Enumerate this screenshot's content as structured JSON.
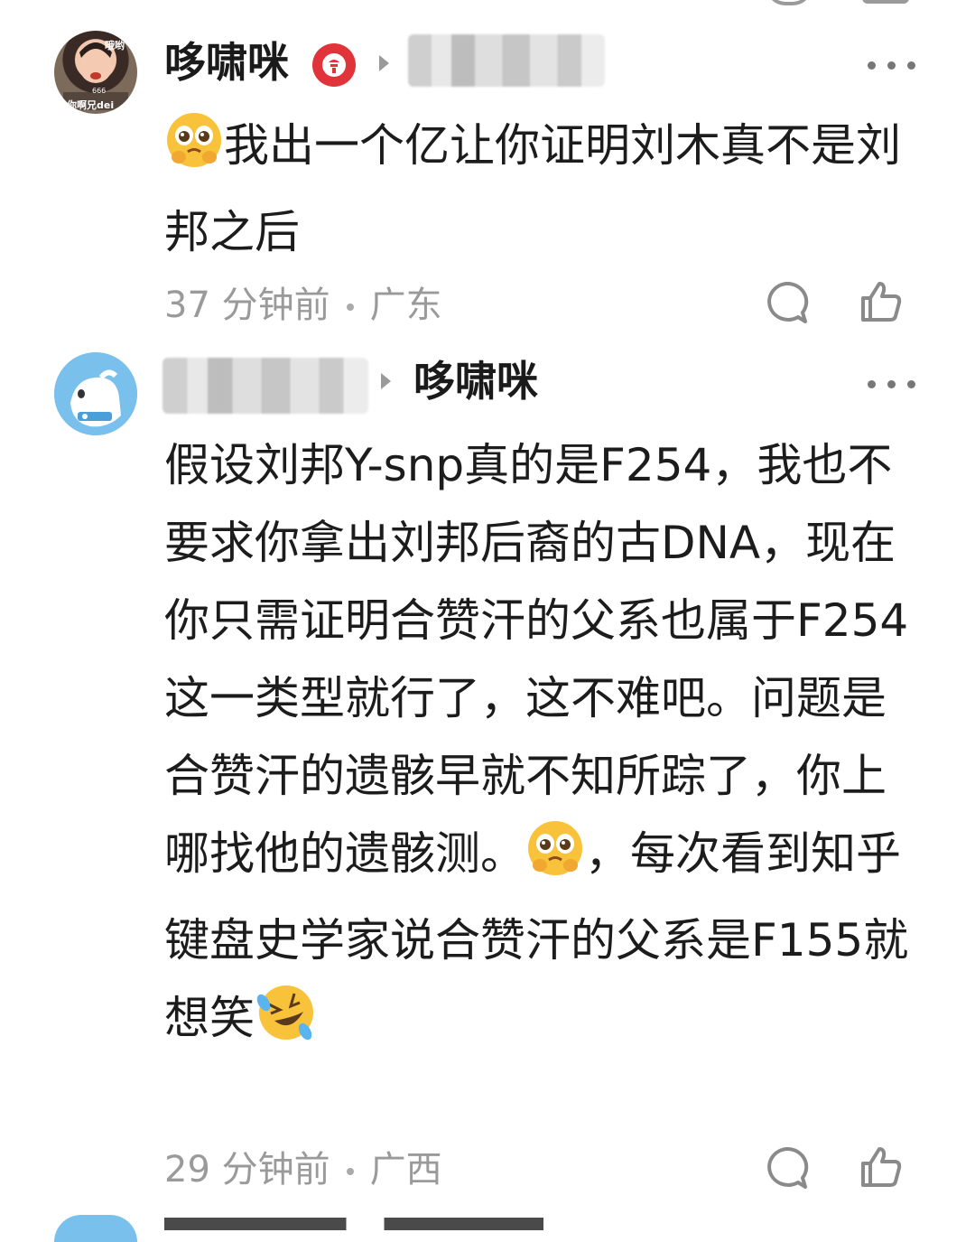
{
  "comments": [
    {
      "username": "哆啸咪",
      "badge_icon": "music-badge-icon",
      "reply_to": "",
      "text_before": "",
      "text_main": "我出一个亿让你证明刘木真不是刘邦之后",
      "time": "37 分钟前",
      "location": "广东"
    },
    {
      "username_hidden": true,
      "reply_to": "哆啸咪",
      "text_part1": "假设刘邦Y-snp真的是F254，我也不要求你拿出刘邦后裔的古DNA，现在你只需证明合赞汗的父系也属于F254这一类型就行了，这不难吧。问题是合赞汗的遗骸早就不知所踪了，你上哪找他的遗骸测。",
      "text_part2": "，每次看到知乎键盘史学家说合赞汗的父系是F155就想笑",
      "time": "29 分钟前",
      "location": "广西"
    }
  ],
  "avatar1_text": [
    "哦哟",
    "666",
    "你啊兄dei"
  ],
  "colors": {
    "badge": "#e0343a",
    "avatar2_bg": "#6fb8e8"
  }
}
